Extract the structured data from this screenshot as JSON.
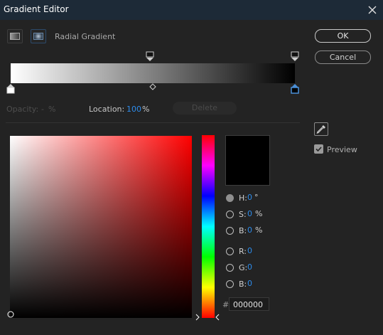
{
  "window": {
    "title": "Gradient Editor"
  },
  "gradient": {
    "type_label": "Radial Gradient",
    "start_color": "#ffffff",
    "end_color": "#000000"
  },
  "buttons": {
    "ok": "OK",
    "cancel": "Cancel",
    "delete": "Delete"
  },
  "stop_fields": {
    "opacity_label": "Opacity:",
    "opacity_value": "-",
    "opacity_unit": "%",
    "location_label": "Location:",
    "location_value": "100",
    "location_unit": "%"
  },
  "preview": {
    "label": "Preview",
    "checked": true
  },
  "color": {
    "h": {
      "label": "H:",
      "value": "0",
      "unit": "°"
    },
    "s": {
      "label": "S:",
      "value": "0",
      "unit": "%"
    },
    "b": {
      "label": "B:",
      "value": "0",
      "unit": "%"
    },
    "r": {
      "label": "R:",
      "value": "0"
    },
    "g": {
      "label": "G:",
      "value": "0"
    },
    "bb": {
      "label": "B:",
      "value": "0"
    },
    "hex_prefix": "#",
    "hex": "000000",
    "swatch": "#000000",
    "selected_mode": "H"
  },
  "icons": [
    "close-icon",
    "linear-gradient-icon",
    "radial-gradient-icon",
    "eyedropper-icon",
    "checkbox-icon"
  ]
}
